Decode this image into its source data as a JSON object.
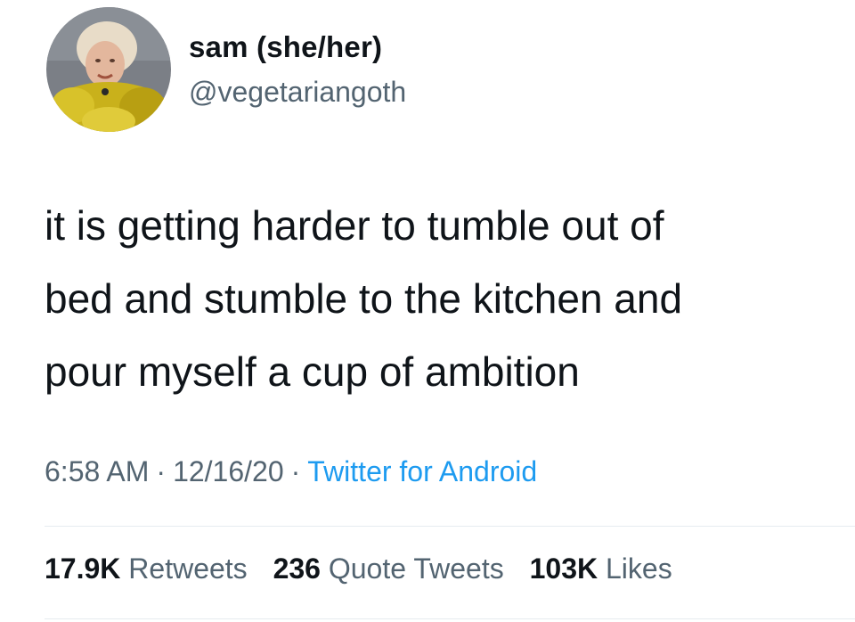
{
  "author": {
    "display_name": "sam (she/her)",
    "handle": "@vegetariangoth",
    "avatar": "avatar-photo"
  },
  "tweet": {
    "lines": [
      "it is getting harder to tumble out of",
      "bed and stumble to the kitchen and",
      "pour myself a cup of ambition"
    ]
  },
  "meta": {
    "time": "6:58 AM",
    "date": "12/16/20",
    "source": "Twitter for Android",
    "separator": "·"
  },
  "stats": {
    "retweets_count": "17.9K",
    "retweets_label": "Retweets",
    "quotes_count": "236",
    "quotes_label": "Quote Tweets",
    "likes_count": "103K",
    "likes_label": "Likes"
  },
  "colors": {
    "text": "#0f1419",
    "secondary": "#536471",
    "link": "#1d9bf0",
    "divider": "#e6ecf0"
  }
}
